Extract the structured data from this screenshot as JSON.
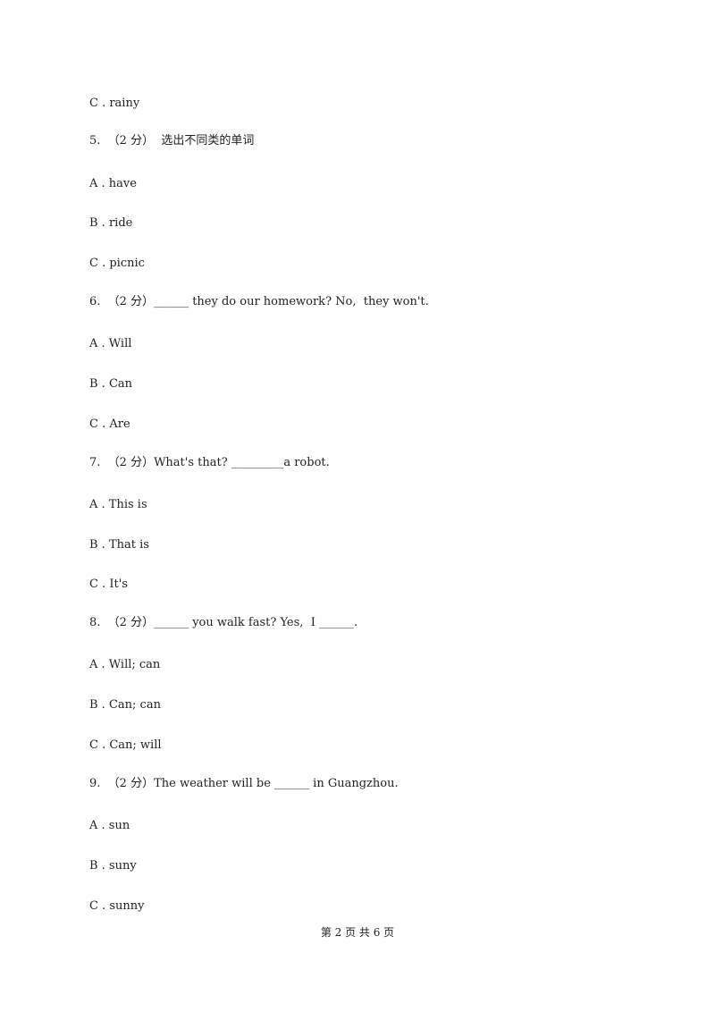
{
  "lines": [
    "C . rainy",
    "5.  （2 分）  选出不同类的单词",
    "A . have",
    "B . ride",
    "C . picnic",
    "6.  （2 分）______ they do our homework? No,  they won't.",
    "A . Will",
    "B . Can",
    "C . Are",
    "7.  （2 分）What's that? _________a robot.",
    "A . This is",
    "B . That is",
    "C . It's",
    "8.  （2 分）______ you walk fast? Yes,  I ______.",
    "A . Will; can",
    "B . Can; can",
    "C . Can; will",
    "9.  （2 分）The weather will be ______ in Guangzhou.",
    "A . sun",
    "B . suny",
    "C . sunny"
  ],
  "footer": "第 2 页 共 6 页"
}
